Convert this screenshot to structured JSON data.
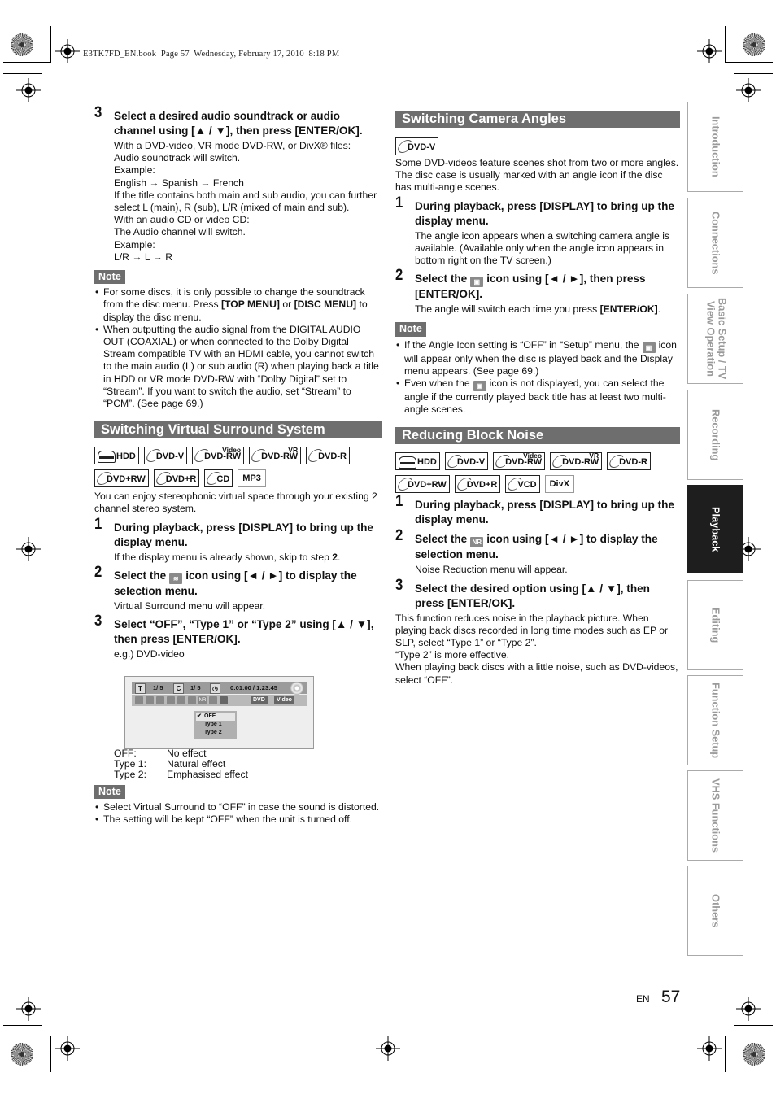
{
  "print_header": "E3TK7FD_EN.book  Page 57  Wednesday, February 17, 2010  8:18 PM",
  "left": {
    "step3": {
      "num": "3",
      "title": "Select a desired audio soundtrack or audio channel using [▲ / ▼], then press [ENTER/OK].",
      "lines": [
        "With a DVD-video, VR mode DVD-RW, or DivX® files:",
        "Audio soundtrack will switch.",
        "Example:",
        "English → Spanish → French",
        "If the title contains both main and sub audio, you can further select L (main), R (sub), L/R (mixed of main and sub).",
        "With an audio CD or video CD:",
        "The Audio channel will switch.",
        "Example:",
        "L/R → L → R"
      ]
    },
    "note1": {
      "label": "Note",
      "items": [
        {
          "pre": "For some discs, it is only possible to change the soundtrack from the disc menu. Press ",
          "b1": "[TOP MENU]",
          "mid": " or ",
          "b2": "[DISC MENU]",
          "post": " to display the disc menu."
        },
        {
          "text": "When outputting the audio signal from the DIGITAL AUDIO OUT (COAXIAL) or when connected to the Dolby Digital Stream compatible TV with an HDMI cable, you cannot switch to the main audio (L) or sub audio (R) when playing back a title in HDD or VR mode DVD-RW with “Dolby Digital” set to “Stream”. If you want to switch the audio, set “Stream” to “PCM”. (See page 69.)"
        }
      ]
    },
    "vss": {
      "heading": "Switching Virtual Surround System",
      "badges": [
        {
          "label": "HDD",
          "icon": "hdd-icon"
        },
        {
          "label": "DVD-V",
          "icon": "disc-icon"
        },
        {
          "label": "DVD-RW",
          "sup": "Video",
          "icon": "disc-icon"
        },
        {
          "label": "DVD-RW",
          "sup": "VR",
          "icon": "disc-icon"
        },
        {
          "label": "DVD-R",
          "icon": "disc-icon"
        },
        {
          "label": "DVD+RW",
          "icon": "disc-icon"
        },
        {
          "label": "DVD+R",
          "icon": "disc-icon"
        },
        {
          "label": "CD",
          "icon": "disc-icon"
        },
        {
          "label": "MP3",
          "icon": ""
        }
      ],
      "intro": "You can enjoy stereophonic virtual space through your existing 2 channel stereo system.",
      "steps": [
        {
          "num": "1",
          "title": "During playback, press [DISPLAY] to bring up the display menu.",
          "body_pre": "If the display menu is already shown, skip to step ",
          "body_bold": "2",
          "body_post": "."
        },
        {
          "num": "2",
          "title_pre": "Select the",
          "icon": "virtual-surround-icon",
          "title_post": "icon using [◄ / ►] to display the selection menu.",
          "body": "Virtual Surround menu will appear."
        },
        {
          "num": "3",
          "title": "Select “OFF”, “Type 1” or “Type 2” using [▲ / ▼], then press [ENTER/OK].",
          "body": "e.g.) DVD-video"
        }
      ],
      "osd": {
        "title_tag": "T",
        "title_val": "1/  5",
        "chapter_tag": "C",
        "chapter_val": "1/  5",
        "time": "0:01:00 / 1:23:45",
        "pill1": "DVD",
        "pill2": "Video",
        "nr_label": "NR",
        "menu": [
          "OFF",
          "Type 1",
          "Type 2"
        ],
        "selected": "OFF"
      },
      "defs": [
        {
          "k": "OFF:",
          "v": "No effect"
        },
        {
          "k": "Type 1:",
          "v": "Natural effect"
        },
        {
          "k": "Type 2:",
          "v": "Emphasised effect"
        }
      ],
      "note": {
        "label": "Note",
        "items": [
          "Select Virtual Surround to “OFF” in case the sound is distorted.",
          "The setting will be kept “OFF” when the unit is turned off."
        ]
      }
    }
  },
  "right": {
    "angles": {
      "heading": "Switching Camera Angles",
      "badge": "DVD-V",
      "intro": "Some DVD-videos feature scenes shot from two or more angles. The disc case is usually marked with an angle icon if the disc has multi-angle scenes.",
      "step1": {
        "num": "1",
        "title": "During playback, press [DISPLAY] to bring up the display menu.",
        "body": "The angle icon appears when a switching camera angle is available. (Available only when the angle icon appears in bottom right on the TV screen.)"
      },
      "step2": {
        "num": "2",
        "title_pre": "Select the",
        "title_post": "icon using [◄ / ►], then press [ENTER/OK].",
        "body_pre": "The angle will switch each time you press ",
        "body_bold": "[ENTER/OK]",
        "body_post": "."
      },
      "note": {
        "label": "Note",
        "items": [
          {
            "pre": "If the Angle Icon setting is “OFF” in “Setup” menu, the",
            "post": "icon will appear only when the disc is played back and the Display menu appears. (See page 69.)"
          },
          {
            "pre": "Even when the",
            "post": "icon is not displayed, you can select the angle if the currently played back title has at least two multi-angle scenes."
          }
        ]
      }
    },
    "noise": {
      "heading": "Reducing Block Noise",
      "badges": [
        {
          "label": "HDD",
          "icon": "hdd-icon"
        },
        {
          "label": "DVD-V",
          "icon": "disc-icon"
        },
        {
          "label": "DVD-RW",
          "sup": "Video",
          "icon": "disc-icon"
        },
        {
          "label": "DVD-RW",
          "sup": "VR",
          "icon": "disc-icon"
        },
        {
          "label": "DVD-R",
          "icon": "disc-icon"
        },
        {
          "label": "DVD+RW",
          "icon": "disc-icon"
        },
        {
          "label": "DVD+R",
          "icon": "disc-icon"
        },
        {
          "label": "VCD",
          "icon": "disc-icon"
        },
        {
          "label": "DivX",
          "icon": ""
        }
      ],
      "steps": [
        {
          "num": "1",
          "title": "During playback, press [DISPLAY] to bring up the display menu."
        },
        {
          "num": "2",
          "title_pre": "Select the",
          "icon_label": "NR",
          "title_post": "icon using [◄ / ►] to display the selection menu.",
          "body": "Noise Reduction menu will appear."
        },
        {
          "num": "3",
          "title": "Select the desired option using [▲ / ▼], then press [ENTER/OK]."
        }
      ],
      "desc": [
        "This function reduces noise in the playback picture. When playing back discs recorded in long time modes such as EP or SLP, select “Type 1” or “Type 2”.",
        "“Type 2” is more effective.",
        "When playing back discs with a little noise, such as DVD-videos, select “OFF”."
      ]
    }
  },
  "side_tabs": [
    {
      "label": "Introduction",
      "active": false
    },
    {
      "label": "Connections",
      "active": false
    },
    {
      "label": "Basic Setup / TV View Operation",
      "active": false
    },
    {
      "label": "Recording",
      "active": false
    },
    {
      "label": "Playback",
      "active": true
    },
    {
      "label": "Editing",
      "active": false
    },
    {
      "label": "Function Setup",
      "active": false
    },
    {
      "label": "VHS Functions",
      "active": false
    },
    {
      "label": "Others",
      "active": false
    }
  ],
  "footer": {
    "lang": "EN",
    "page": "57"
  }
}
